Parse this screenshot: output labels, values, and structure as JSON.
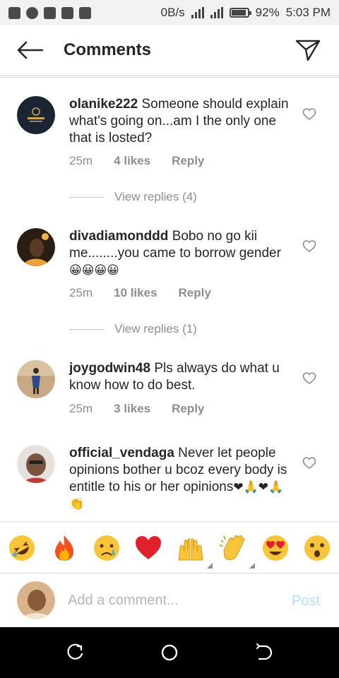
{
  "status_bar": {
    "network_speed": "0B/s",
    "battery": "92%",
    "battery_level": 0.92,
    "time": "5:03 PM"
  },
  "header": {
    "title": "Comments",
    "back_icon": "arrow-left-icon",
    "action_icon": "send-direct-icon"
  },
  "comments": [
    {
      "username": "olanike222",
      "text": "Someone should explain what's going on...am I the only one that is losted?",
      "emoji": "",
      "time": "25m",
      "likes": "4 likes",
      "reply": "Reply",
      "view_replies": "View replies (4)",
      "avatar_color": "#1b2433"
    },
    {
      "username": "divadiamonddd",
      "text": "Bobo no go kii me........you came to borrow gender",
      "emoji": "😀😀😀😀",
      "time": "25m",
      "likes": "10 likes",
      "reply": "Reply",
      "view_replies": "View replies (1)",
      "avatar_color": "#2a1d14"
    },
    {
      "username": "joygodwin48",
      "text": "Pls always do what u know how to do best.",
      "emoji": "",
      "time": "25m",
      "likes": "3 likes",
      "reply": "Reply",
      "avatar_color": "#c9a983"
    },
    {
      "username": "official_vendaga",
      "text": "Never let people opinions bother u bcoz every body is entitle to his or her opinions",
      "emoji": "❤🙏❤🙏👏",
      "avatar_color": "#8d6e63"
    }
  ],
  "emoji_bar": [
    {
      "name": "rolling-laughing-emoji"
    },
    {
      "name": "fire-emoji"
    },
    {
      "name": "crying-face-emoji"
    },
    {
      "name": "red-heart-emoji"
    },
    {
      "name": "raising-hands-emoji"
    },
    {
      "name": "clapping-hands-emoji"
    },
    {
      "name": "heart-eyes-emoji"
    },
    {
      "name": "astonished-face-emoji"
    }
  ],
  "composer": {
    "placeholder": "Add a comment...",
    "post_label": "Post"
  },
  "colors": {
    "text": "#262626",
    "secondary": "#8e8e8e",
    "post_disabled": "#b2dffc",
    "divider": "#dbdbdb"
  }
}
